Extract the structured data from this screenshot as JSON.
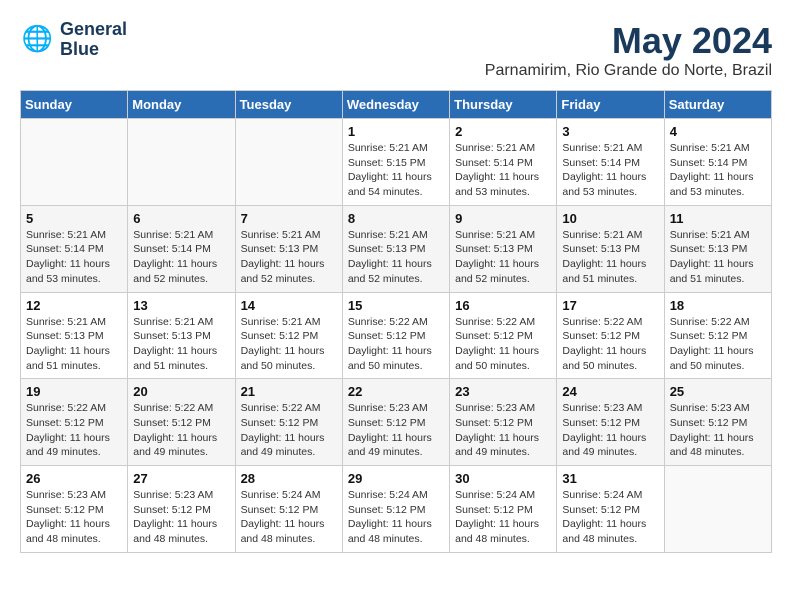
{
  "header": {
    "logo_line1": "General",
    "logo_line2": "Blue",
    "month": "May 2024",
    "location": "Parnamirim, Rio Grande do Norte, Brazil"
  },
  "weekdays": [
    "Sunday",
    "Monday",
    "Tuesday",
    "Wednesday",
    "Thursday",
    "Friday",
    "Saturday"
  ],
  "weeks": [
    [
      {
        "day": "",
        "info": ""
      },
      {
        "day": "",
        "info": ""
      },
      {
        "day": "",
        "info": ""
      },
      {
        "day": "1",
        "info": "Sunrise: 5:21 AM\nSunset: 5:15 PM\nDaylight: 11 hours\nand 54 minutes."
      },
      {
        "day": "2",
        "info": "Sunrise: 5:21 AM\nSunset: 5:14 PM\nDaylight: 11 hours\nand 53 minutes."
      },
      {
        "day": "3",
        "info": "Sunrise: 5:21 AM\nSunset: 5:14 PM\nDaylight: 11 hours\nand 53 minutes."
      },
      {
        "day": "4",
        "info": "Sunrise: 5:21 AM\nSunset: 5:14 PM\nDaylight: 11 hours\nand 53 minutes."
      }
    ],
    [
      {
        "day": "5",
        "info": "Sunrise: 5:21 AM\nSunset: 5:14 PM\nDaylight: 11 hours\nand 53 minutes."
      },
      {
        "day": "6",
        "info": "Sunrise: 5:21 AM\nSunset: 5:14 PM\nDaylight: 11 hours\nand 52 minutes."
      },
      {
        "day": "7",
        "info": "Sunrise: 5:21 AM\nSunset: 5:13 PM\nDaylight: 11 hours\nand 52 minutes."
      },
      {
        "day": "8",
        "info": "Sunrise: 5:21 AM\nSunset: 5:13 PM\nDaylight: 11 hours\nand 52 minutes."
      },
      {
        "day": "9",
        "info": "Sunrise: 5:21 AM\nSunset: 5:13 PM\nDaylight: 11 hours\nand 52 minutes."
      },
      {
        "day": "10",
        "info": "Sunrise: 5:21 AM\nSunset: 5:13 PM\nDaylight: 11 hours\nand 51 minutes."
      },
      {
        "day": "11",
        "info": "Sunrise: 5:21 AM\nSunset: 5:13 PM\nDaylight: 11 hours\nand 51 minutes."
      }
    ],
    [
      {
        "day": "12",
        "info": "Sunrise: 5:21 AM\nSunset: 5:13 PM\nDaylight: 11 hours\nand 51 minutes."
      },
      {
        "day": "13",
        "info": "Sunrise: 5:21 AM\nSunset: 5:13 PM\nDaylight: 11 hours\nand 51 minutes."
      },
      {
        "day": "14",
        "info": "Sunrise: 5:21 AM\nSunset: 5:12 PM\nDaylight: 11 hours\nand 50 minutes."
      },
      {
        "day": "15",
        "info": "Sunrise: 5:22 AM\nSunset: 5:12 PM\nDaylight: 11 hours\nand 50 minutes."
      },
      {
        "day": "16",
        "info": "Sunrise: 5:22 AM\nSunset: 5:12 PM\nDaylight: 11 hours\nand 50 minutes."
      },
      {
        "day": "17",
        "info": "Sunrise: 5:22 AM\nSunset: 5:12 PM\nDaylight: 11 hours\nand 50 minutes."
      },
      {
        "day": "18",
        "info": "Sunrise: 5:22 AM\nSunset: 5:12 PM\nDaylight: 11 hours\nand 50 minutes."
      }
    ],
    [
      {
        "day": "19",
        "info": "Sunrise: 5:22 AM\nSunset: 5:12 PM\nDaylight: 11 hours\nand 49 minutes."
      },
      {
        "day": "20",
        "info": "Sunrise: 5:22 AM\nSunset: 5:12 PM\nDaylight: 11 hours\nand 49 minutes."
      },
      {
        "day": "21",
        "info": "Sunrise: 5:22 AM\nSunset: 5:12 PM\nDaylight: 11 hours\nand 49 minutes."
      },
      {
        "day": "22",
        "info": "Sunrise: 5:23 AM\nSunset: 5:12 PM\nDaylight: 11 hours\nand 49 minutes."
      },
      {
        "day": "23",
        "info": "Sunrise: 5:23 AM\nSunset: 5:12 PM\nDaylight: 11 hours\nand 49 minutes."
      },
      {
        "day": "24",
        "info": "Sunrise: 5:23 AM\nSunset: 5:12 PM\nDaylight: 11 hours\nand 49 minutes."
      },
      {
        "day": "25",
        "info": "Sunrise: 5:23 AM\nSunset: 5:12 PM\nDaylight: 11 hours\nand 48 minutes."
      }
    ],
    [
      {
        "day": "26",
        "info": "Sunrise: 5:23 AM\nSunset: 5:12 PM\nDaylight: 11 hours\nand 48 minutes."
      },
      {
        "day": "27",
        "info": "Sunrise: 5:23 AM\nSunset: 5:12 PM\nDaylight: 11 hours\nand 48 minutes."
      },
      {
        "day": "28",
        "info": "Sunrise: 5:24 AM\nSunset: 5:12 PM\nDaylight: 11 hours\nand 48 minutes."
      },
      {
        "day": "29",
        "info": "Sunrise: 5:24 AM\nSunset: 5:12 PM\nDaylight: 11 hours\nand 48 minutes."
      },
      {
        "day": "30",
        "info": "Sunrise: 5:24 AM\nSunset: 5:12 PM\nDaylight: 11 hours\nand 48 minutes."
      },
      {
        "day": "31",
        "info": "Sunrise: 5:24 AM\nSunset: 5:12 PM\nDaylight: 11 hours\nand 48 minutes."
      },
      {
        "day": "",
        "info": ""
      }
    ]
  ]
}
